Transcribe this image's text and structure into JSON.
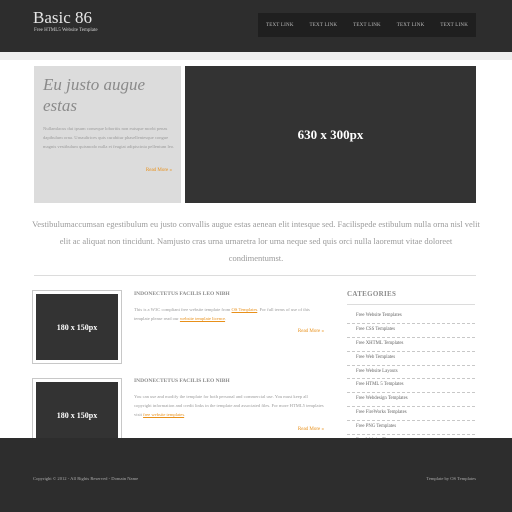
{
  "header": {
    "title": "Basic 86",
    "tagline": "Free HTML5 Website Template",
    "nav": [
      "TEXT LINK",
      "TEXT LINK",
      "TEXT LINK",
      "TEXT LINK",
      "TEXT LINK"
    ]
  },
  "intro": {
    "heading": "Eu justo augue estas",
    "text": "Nullamlacus dui ipsum conseque loborttis non euisque morbi penas dapibulum orna. Urnaultrices quis curabitur phasellentesque congue magnis vestibulum quismodo nulla et feugiat adipiscinia pellentum leo.",
    "read_more": "Read More »"
  },
  "hero": {
    "label": "630 x 300px"
  },
  "tagline": "Vestibulumaccumsan egestibulum eu justo convallis augue estas aenean elit intesque sed. Facilispede estibulum nulla orna nisl velit elit ac aliquat non tincidunt. Namjusto cras urna urnaretra lor urna neque sed quis orci nulla laoremut vitae doloreet condimentumst.",
  "articles": [
    {
      "thumb": "180 x 150px",
      "title": "INDONECTETUS FACILIS LEO NIBH",
      "text_before": "This is a W3C compliant free website template from ",
      "link1": "OS Templates",
      "text_middle": ". For full terms of use of this template please read our ",
      "link2": "website template licence",
      "text_after": ".",
      "read_more": "Read More »"
    },
    {
      "thumb": "180 x 150px",
      "title": "INDONECTETUS FACILIS LEO NIBH",
      "text_before": "You can use and modify the template for both personal and commercial use. You must keep all copyright information and credit links in the template and associated files. For more HTML5 templates visit ",
      "link1": "free website templates",
      "text_middle": ".",
      "link2": "",
      "text_after": "",
      "read_more": "Read More »"
    }
  ],
  "categories": {
    "title": "CATEGORIES",
    "items": [
      "Free Website Templates",
      "Free CSS Templates",
      "Free XHTML Templates",
      "Free Web Templates",
      "Free Website Layouts",
      "Free HTML 5 Templates",
      "Free Webdesign Templates",
      "Free FireWorks Templates",
      "Free PNG Templates",
      "Free Website Themes"
    ]
  },
  "footer": {
    "copyright": "Copyright © 2012 - All Rights Reserved - Domain Name",
    "credit": "Template by OS Templates"
  },
  "colors": {
    "accent": "#e8901a",
    "dark": "#2d2d2d",
    "placeholder": "#333333"
  }
}
